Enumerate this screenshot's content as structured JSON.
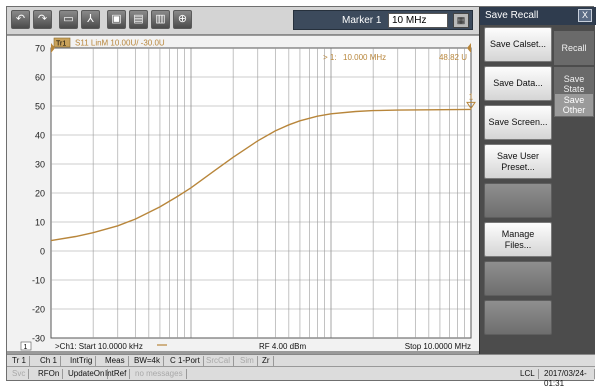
{
  "toolbar": {
    "buttons": [
      {
        "name": "undo-icon",
        "glyph": "↶"
      },
      {
        "name": "redo-icon",
        "glyph": "↷"
      },
      {
        "name": "open-folder-icon",
        "glyph": "▭"
      },
      {
        "name": "trace-icon",
        "glyph": "⅄"
      },
      {
        "name": "save-icon",
        "glyph": "▣"
      },
      {
        "name": "print-icon",
        "glyph": "▤"
      },
      {
        "name": "delete-icon",
        "glyph": "▥"
      },
      {
        "name": "zoom-icon",
        "glyph": "⊕"
      }
    ],
    "marker_label": "Marker 1",
    "marker_value": "10 MHz",
    "keypad_glyph": "▦"
  },
  "trace": {
    "badge": "Tr1",
    "title": "S11 LinM 10.00U/ -30.0U",
    "marker_readout_label": "> 1:",
    "marker_readout_freq": "10.000 MHz",
    "marker_readout_value": "48.82 U",
    "marker_flag": "1",
    "bottom_badge": "1",
    "footer_start": ">Ch1: Start 10.0000 kHz",
    "footer_power": "RF   4.00 dBm",
    "footer_stop": "Stop 10.0000 MHz",
    "color": "#b8863b"
  },
  "chart_data": {
    "type": "line",
    "x_scale": "log",
    "xlim": [
      10,
      10000
    ],
    "x_unit": "kHz",
    "ylim": [
      -30,
      70
    ],
    "y_ticks": [
      70,
      60,
      50,
      40,
      30,
      20,
      10,
      0,
      -10,
      -20,
      -30
    ],
    "grid": true,
    "series": [
      {
        "x": [
          10,
          15,
          20,
          30,
          40,
          60,
          80,
          100,
          150,
          200,
          300,
          400,
          500,
          600,
          800,
          1000,
          1500,
          2000,
          3000,
          5000,
          10000
        ],
        "y": [
          3.6,
          5.0,
          6.3,
          8.7,
          11.0,
          15.2,
          18.8,
          21.8,
          28.0,
          32.3,
          38.0,
          41.4,
          43.5,
          44.9,
          46.5,
          47.3,
          48.1,
          48.4,
          48.6,
          48.7,
          48.82
        ]
      }
    ]
  },
  "side_panel": {
    "title": "Save Recall",
    "close_glyph": "X",
    "buttons": [
      "Save Calset...",
      "Save Data...",
      "Save Screen...",
      "Save User Preset...",
      "",
      "Manage Files...",
      "",
      ""
    ],
    "tabs": [
      "Recall",
      "Save State",
      "Save Other"
    ],
    "active_tab": 2
  },
  "status_bar_1": [
    "Tr 1",
    "Ch 1",
    "IntTrig",
    "Meas",
    "BW=4k",
    "C  1-Port",
    "SrcCal",
    "Sim",
    "Zr"
  ],
  "status_bar_2": [
    "Svc",
    "RFOn",
    "UpdateOn",
    "IntRef",
    "no messages",
    "LCL",
    "2017/03/24-01:31"
  ]
}
